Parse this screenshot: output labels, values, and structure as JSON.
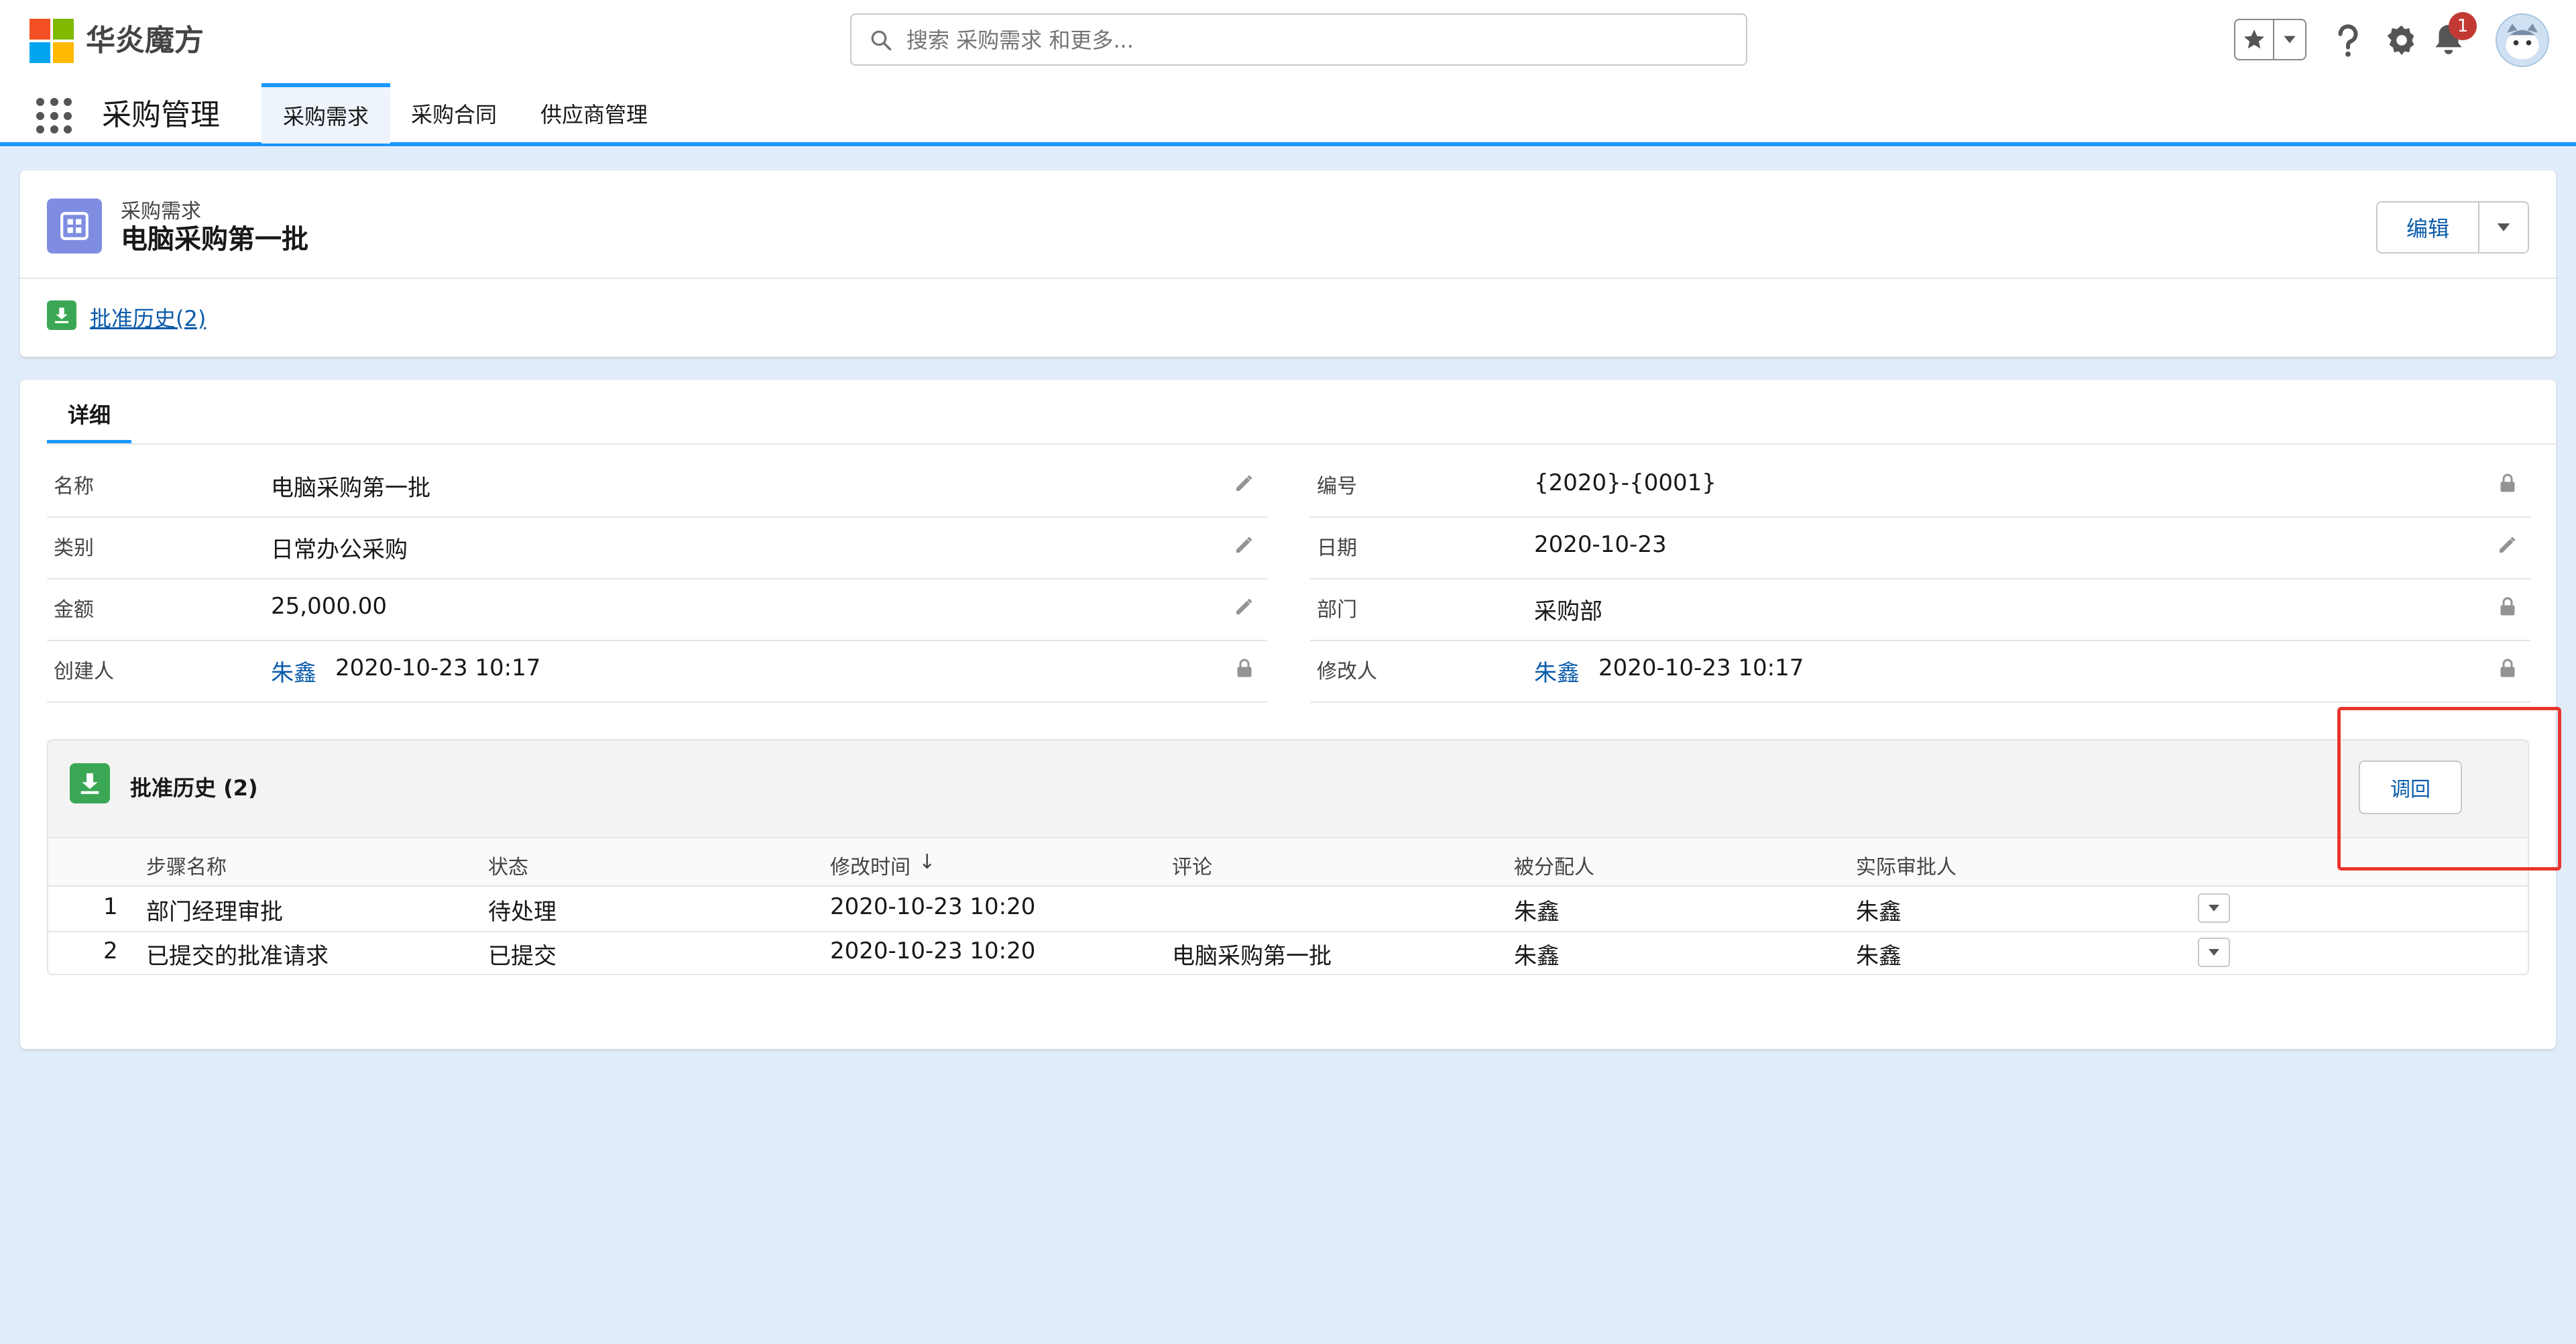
{
  "header": {
    "brand": "华炎魔方",
    "search_placeholder": "搜索 采购需求 和更多...",
    "notification_count": "1",
    "colors": {
      "brand_blue": "#1b96ff",
      "link": "#0b5cab",
      "logo": [
        "#f25022",
        "#7fba00",
        "#00a4ef",
        "#ffb900"
      ]
    }
  },
  "nav": {
    "app_name": "采购管理",
    "tabs": [
      {
        "label": "采购需求",
        "active": true
      },
      {
        "label": "采购合同",
        "active": false
      },
      {
        "label": "供应商管理",
        "active": false
      }
    ]
  },
  "record": {
    "object_type": "采购需求",
    "title": "电脑采购第一批",
    "edit_label": "编辑",
    "quick_link": "批准历史(2)"
  },
  "detail": {
    "tab_label": "详细",
    "left_fields": [
      {
        "label": "名称",
        "value": "电脑采购第一批",
        "editable": true
      },
      {
        "label": "类别",
        "value": "日常办公采购",
        "editable": true
      },
      {
        "label": "金额",
        "value": "25,000.00",
        "editable": true
      },
      {
        "label": "创建人",
        "user": "朱鑫",
        "value": "2020-10-23 10:17",
        "editable": false
      }
    ],
    "right_fields": [
      {
        "label": "编号",
        "value": "{2020}-{0001}",
        "editable": false
      },
      {
        "label": "日期",
        "value": "2020-10-23",
        "editable": true
      },
      {
        "label": "部门",
        "value": "采购部",
        "editable": false
      },
      {
        "label": "修改人",
        "user": "朱鑫",
        "value": "2020-10-23 10:17",
        "editable": false
      }
    ]
  },
  "approval_history": {
    "title": "批准历史 (2)",
    "recall_label": "调回",
    "columns": [
      "步骤名称",
      "状态",
      "修改时间",
      "评论",
      "被分配人",
      "实际审批人"
    ],
    "sort_indicator": "↓",
    "rows": [
      {
        "index": "1",
        "step": "部门经理审批",
        "status": "待处理",
        "time": "2020-10-23 10:20",
        "comment": "",
        "assignee": "朱鑫",
        "approver": "朱鑫"
      },
      {
        "index": "2",
        "step": "已提交的批准请求",
        "status": "已提交",
        "time": "2020-10-23 10:20",
        "comment": "电脑采购第一批",
        "assignee": "朱鑫",
        "approver": "朱鑫"
      }
    ]
  }
}
